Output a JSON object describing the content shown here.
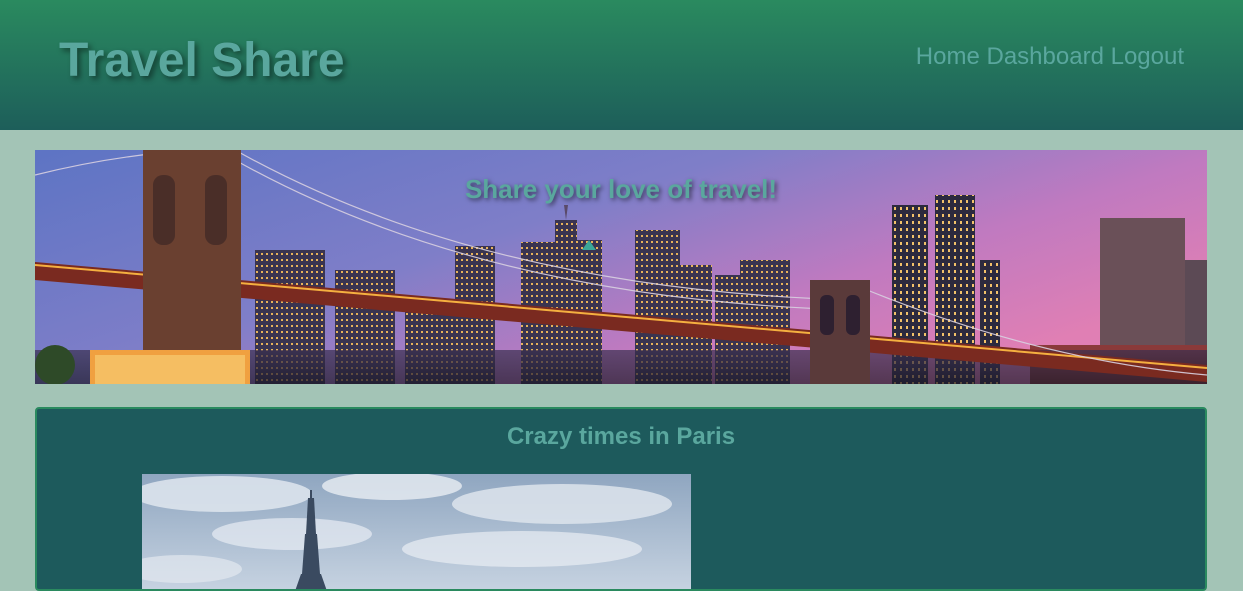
{
  "header": {
    "title": "Travel Share",
    "nav": [
      {
        "label": "Home"
      },
      {
        "label": "Dashboard"
      },
      {
        "label": "Logout"
      }
    ]
  },
  "banner": {
    "tagline": "Share your love of travel!",
    "image": "brooklyn-bridge-skyline-photo"
  },
  "post": {
    "title": "Crazy times in Paris",
    "image": "eiffel-tower-photo"
  },
  "colors": {
    "header_top": "#2a8a5f",
    "header_bottom": "#1d5e5a",
    "page_bg": "#a3c4b6",
    "title_text": "#5aa79e",
    "card_bg": "#1d5a5c",
    "card_border": "#2a8a5f"
  }
}
